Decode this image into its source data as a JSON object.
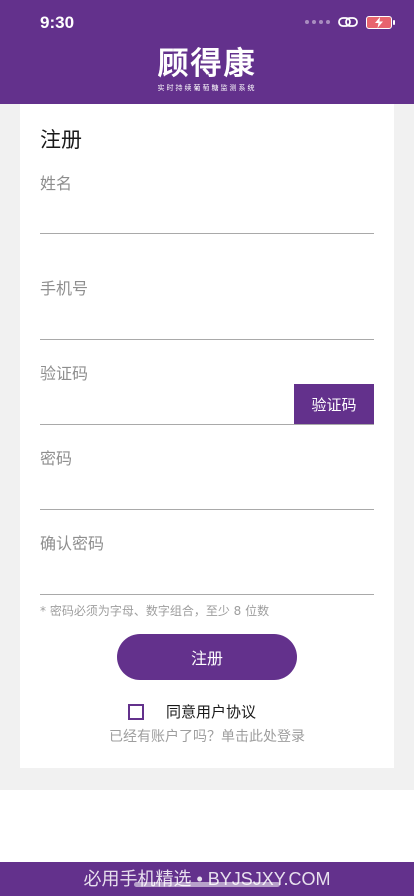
{
  "status_bar": {
    "time": "9:30"
  },
  "header": {
    "logo_title": "顾得康",
    "logo_subtitle": "实时持续葡萄糖监测系统",
    "brand_color": "#63318c"
  },
  "form": {
    "title": "注册",
    "fields": [
      {
        "label": "姓名",
        "value": ""
      },
      {
        "label": "手机号",
        "value": ""
      },
      {
        "label": "验证码",
        "value": ""
      },
      {
        "label": "密码",
        "value": ""
      },
      {
        "label": "确认密码",
        "value": ""
      }
    ],
    "code_button_label": "验证码",
    "password_hint": "* 密码必须为字母、数字组合，至少 8 位数",
    "register_button_label": "注册",
    "agree_label": "同意用户协议",
    "login_link": "已经有账户了吗？单击此处登录"
  },
  "footer": {
    "watermark": "必用手机精选 • BYJSJXY.COM"
  }
}
